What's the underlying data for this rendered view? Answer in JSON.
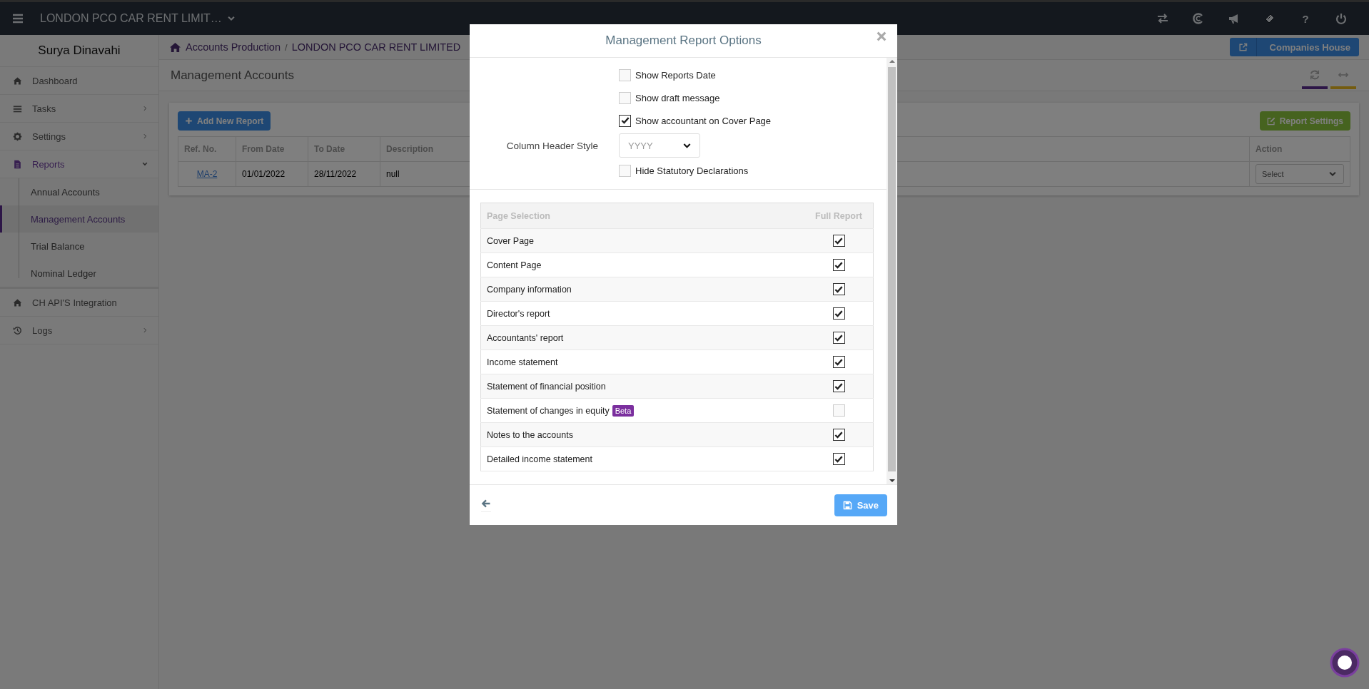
{
  "top_bar": {
    "company": "LONDON PCO CAR RENT LIMIT…",
    "help": "?"
  },
  "sidebar": {
    "user": "Surya Dinavahi",
    "items": [
      {
        "label": "Dashboard",
        "kind": "link",
        "selected": false
      },
      {
        "label": "Tasks",
        "kind": "group",
        "expanded": false,
        "selected": false
      },
      {
        "label": "Settings",
        "kind": "group",
        "expanded": false,
        "selected": false
      },
      {
        "label": "Reports",
        "kind": "group",
        "expanded": true,
        "selected": true,
        "children": [
          {
            "label": "Annual Accounts",
            "selected": false
          },
          {
            "label": "Management Accounts",
            "selected": true
          },
          {
            "label": "Trial Balance",
            "selected": false
          },
          {
            "label": "Nominal Ledger",
            "selected": false
          }
        ]
      },
      {
        "label": "CH API'S Integration",
        "kind": "link",
        "selected": false
      },
      {
        "label": "Logs",
        "kind": "group",
        "expanded": false,
        "selected": false
      }
    ]
  },
  "breadcrumb": {
    "items": [
      "Accounts Production",
      "LONDON PCO CAR RENT LIMITED"
    ],
    "separator": "/"
  },
  "header_button": "Companies House",
  "page_title": "Management Accounts",
  "toolbar": {
    "add_button": "Add New Report",
    "settings_button": "Report Settings"
  },
  "table": {
    "columns": [
      "Ref. No.",
      "From Date",
      "To Date",
      "Description",
      "Action"
    ],
    "rows": [
      {
        "ref": "MA-2",
        "from": "01/01/2022",
        "to": "28/11/2022",
        "description": "null",
        "action": "Select"
      }
    ]
  },
  "modal": {
    "title": "Management Report Options",
    "options": [
      {
        "kind": "checkbox",
        "label": "Show Reports Date",
        "checked": false
      },
      {
        "kind": "checkbox",
        "label": "Show draft message",
        "checked": false
      },
      {
        "kind": "checkbox",
        "label": "Show accountant on Cover Page",
        "checked": true
      },
      {
        "kind": "select",
        "label": "Column Header Style",
        "value": "YYYY"
      },
      {
        "kind": "checkbox",
        "label": "Hide Statutory Declarations",
        "checked": false
      }
    ],
    "pages": {
      "columns": [
        "Page Selection",
        "Full Report"
      ],
      "rows": [
        {
          "label": "Cover Page",
          "checked": true
        },
        {
          "label": "Content Page",
          "checked": true
        },
        {
          "label": "Company information",
          "checked": true
        },
        {
          "label": "Director's report",
          "checked": true
        },
        {
          "label": "Accountants' report",
          "checked": true
        },
        {
          "label": "Income statement",
          "checked": true
        },
        {
          "label": "Statement of financial position",
          "checked": true
        },
        {
          "label": "Statement of changes in equity",
          "checked": false,
          "badge": "Beta"
        },
        {
          "label": "Notes to the accounts",
          "checked": true
        },
        {
          "label": "Detailed income statement",
          "checked": true
        }
      ]
    },
    "save_button": "Save"
  }
}
